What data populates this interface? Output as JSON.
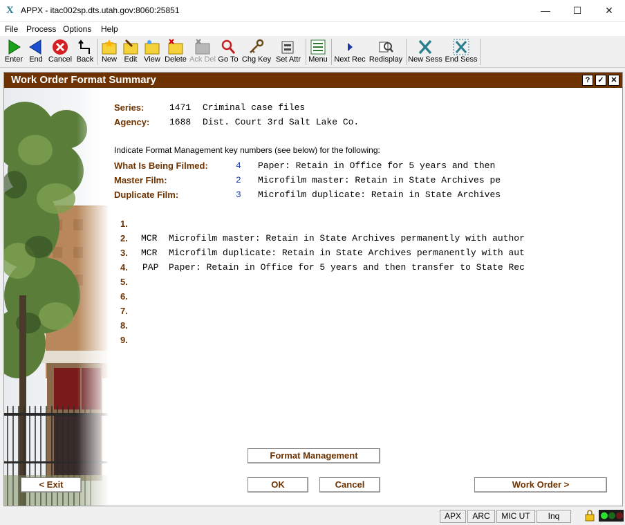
{
  "window": {
    "title": "APPX - itac002sp.dts.utah.gov:8060:25851",
    "icon": "appx-x-icon"
  },
  "menu": [
    "File",
    "Process",
    "Options",
    "Help"
  ],
  "toolbar": [
    {
      "label": "Enter",
      "icon": "green-arrow-right-icon"
    },
    {
      "label": "End",
      "icon": "blue-arrow-left-icon"
    },
    {
      "label": "Cancel",
      "icon": "red-x-circle-icon"
    },
    {
      "label": "Back",
      "icon": "back-arrow-icon"
    },
    {
      "label": "New",
      "icon": "new-folder-icon"
    },
    {
      "label": "Edit",
      "icon": "edit-folder-icon"
    },
    {
      "label": "View",
      "icon": "view-folder-icon"
    },
    {
      "label": "Delete",
      "icon": "delete-folder-icon"
    },
    {
      "label": "Ack Del",
      "icon": "ack-delete-icon"
    },
    {
      "label": "Go To",
      "icon": "magnifier-icon"
    },
    {
      "label": "Chg Key",
      "icon": "key-icon"
    },
    {
      "label": "Set Attr",
      "icon": "set-attr-icon"
    },
    {
      "label": "Menu",
      "icon": "menu-list-icon"
    },
    {
      "label": "Next Rec",
      "icon": "next-triangle-icon"
    },
    {
      "label": "Redisplay",
      "icon": "redisplay-icon"
    },
    {
      "label": "New Sess",
      "icon": "new-session-icon"
    },
    {
      "label": "End Sess",
      "icon": "end-session-icon"
    }
  ],
  "frame": {
    "title": "Work Order Format Summary",
    "help_btn": "?",
    "ok_btn": "✓",
    "close_btn": "✕"
  },
  "form": {
    "series_label": "Series:",
    "series_num": "1471",
    "series_name": "Criminal case files",
    "agency_label": "Agency:",
    "agency_num": "1688",
    "agency_name": "Dist. Court 3rd Salt Lake Co.",
    "instruction": "Indicate Format Management key numbers (see below) for the following:",
    "filmed_label": "What Is Being Filmed:",
    "filmed_key": "4",
    "filmed_desc": "Paper: Retain in Office for 5 years and then",
    "master_label": "Master Film:",
    "master_key": "2",
    "master_desc": "Microfilm master: Retain in State Archives pe",
    "dup_label": "Duplicate Film:",
    "dup_key": "3",
    "dup_desc": "Microfilm duplicate: Retain in State Archives"
  },
  "key_list": [
    {
      "num": "1.",
      "code": "",
      "desc": ""
    },
    {
      "num": "2.",
      "code": "MCR",
      "desc": "Microfilm master: Retain in State Archives permanently with author"
    },
    {
      "num": "3.",
      "code": "MCR",
      "desc": "Microfilm duplicate: Retain in State Archives permanently with aut"
    },
    {
      "num": "4.",
      "code": "PAP",
      "desc": "Paper: Retain in Office for 5 years and then transfer to State Rec"
    },
    {
      "num": "5.",
      "code": "",
      "desc": ""
    },
    {
      "num": "6.",
      "code": "",
      "desc": ""
    },
    {
      "num": "7.",
      "code": "",
      "desc": ""
    },
    {
      "num": "8.",
      "code": "",
      "desc": ""
    },
    {
      "num": "9.",
      "code": "",
      "desc": ""
    }
  ],
  "buttons": {
    "format_mgmt": "Format Management",
    "exit": "< Exit",
    "ok": "OK",
    "cancel": "Cancel",
    "work_order": "Work Order >"
  },
  "status": {
    "apx": "APX",
    "arc": "ARC",
    "mic": "MIC UT",
    "inq": "Inq"
  }
}
